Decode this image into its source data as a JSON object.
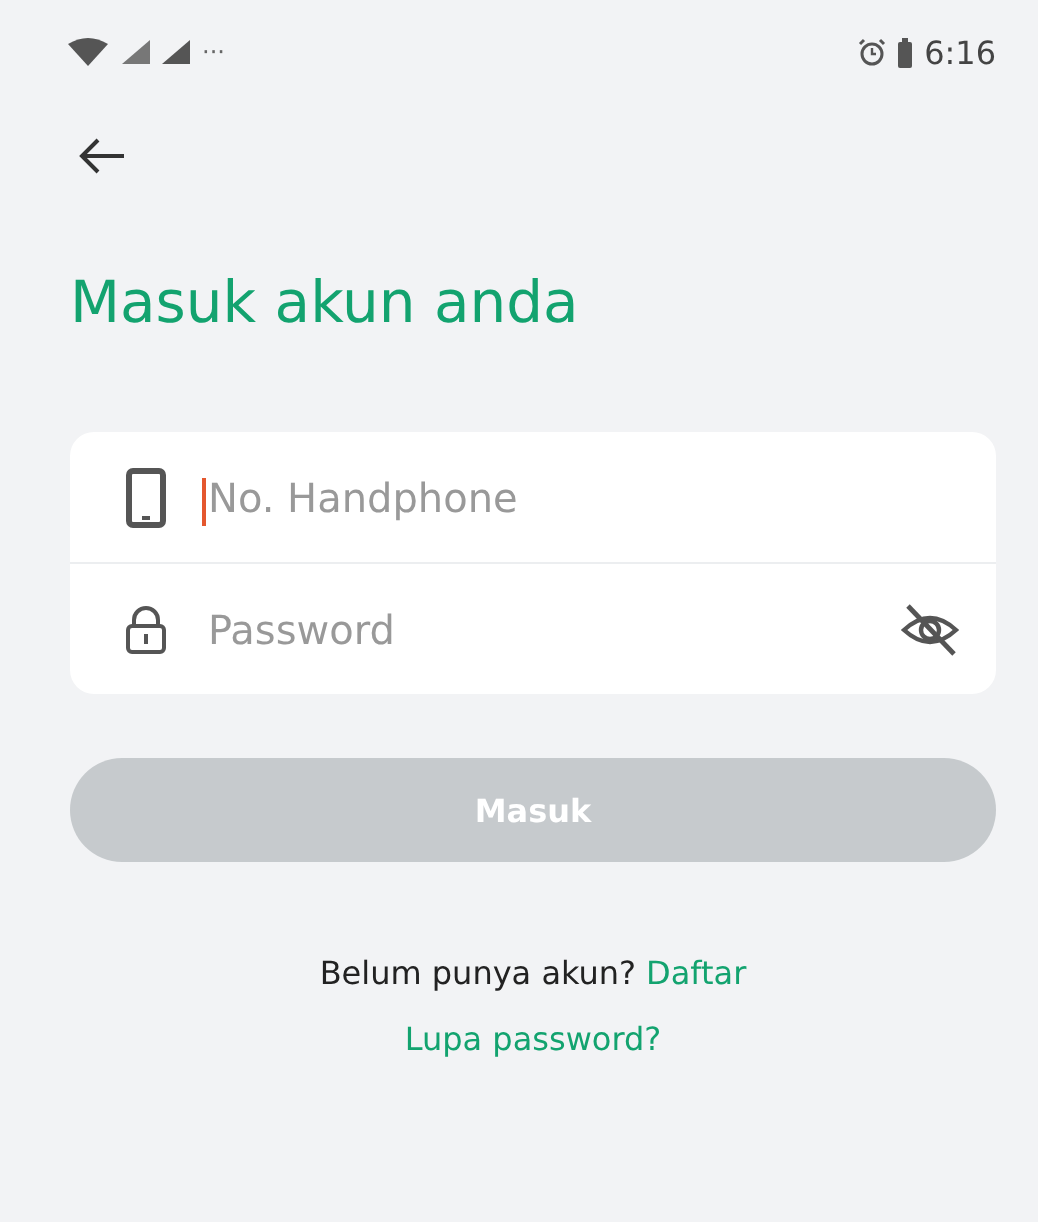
{
  "status_bar": {
    "more": "···",
    "time": "6:16"
  },
  "title": "Masuk akun anda",
  "fields": [
    {
      "kind": "phone",
      "placeholder": "No. Handphone",
      "focused": true
    },
    {
      "kind": "password",
      "placeholder": "Password",
      "focused": false,
      "visible": false
    }
  ],
  "login_button": {
    "label": "Masuk",
    "disabled": true
  },
  "signup": {
    "text": "Belum punya akun?",
    "link": "Daftar"
  },
  "forgot_link": "Lupa password?"
}
